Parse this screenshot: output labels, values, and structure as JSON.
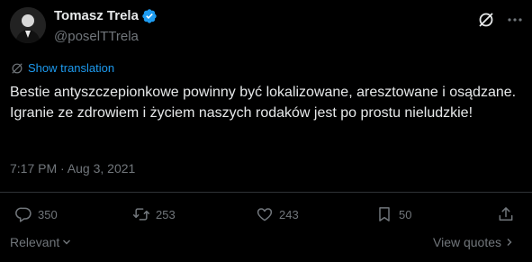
{
  "author": {
    "display_name": "Tomasz Trela",
    "handle": "@poselTTrela",
    "verified_icon": "verified-badge-icon",
    "avatar_icon": "profile-avatar"
  },
  "header_icons": [
    "grok-icon",
    "more-options-icon"
  ],
  "translation": {
    "label": "Show translation",
    "icon": "globe-icon"
  },
  "tweet": {
    "text": "Bestie antyszczepionkowe powinny być lokalizowane, aresztowane i osądzane. Igranie ze zdrowiem i życiem naszych rodaków jest po prostu nieludzkie!",
    "timestamp": "7:17 PM · Aug 3, 2021"
  },
  "actions": {
    "replies": "350",
    "reposts": "253",
    "likes": "243",
    "bookmarks": "50"
  },
  "footer": {
    "sort_label": "Relevant",
    "view_quotes_label": "View quotes"
  },
  "colors": {
    "background": "#000000",
    "text": "#e7e9ea",
    "muted": "#71767b",
    "accent": "#1d9bf0",
    "divider": "#2f3336"
  }
}
